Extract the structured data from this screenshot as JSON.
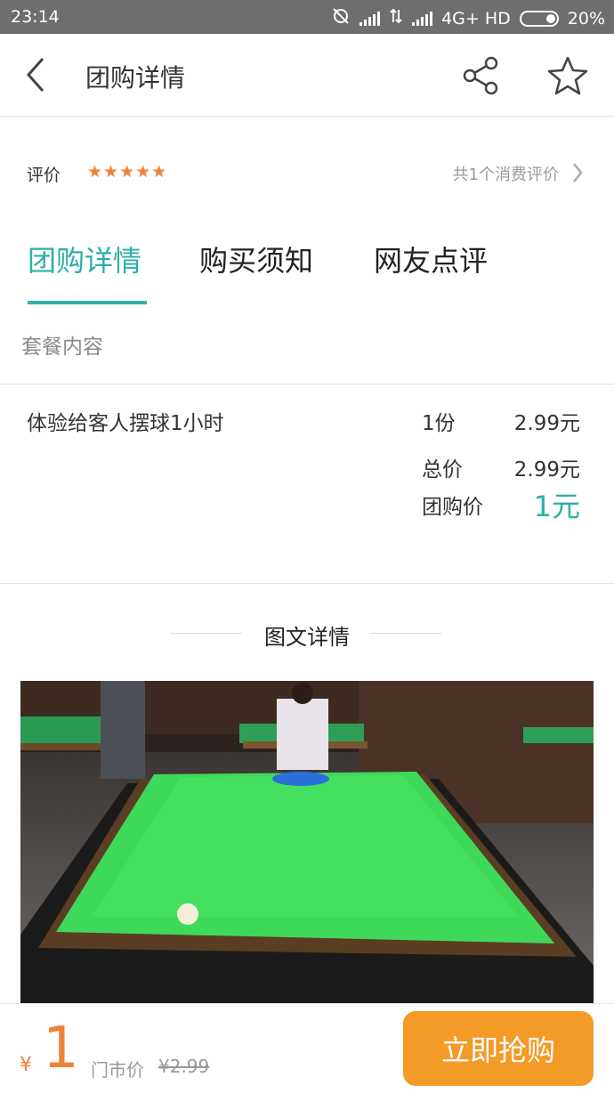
{
  "status_bar": {
    "time": "23:14",
    "network": "4G+ HD",
    "battery": "20%"
  },
  "app_bar": {
    "title": "团购详情",
    "back_icon": "back-arrow-icon",
    "share_icon": "share-icon",
    "favorite_icon": "star-outline-icon"
  },
  "rating": {
    "label": "评价",
    "stars": "★★★★★",
    "count_text": "共1个消费评价"
  },
  "tabs": [
    {
      "label": "团购详情",
      "active": true
    },
    {
      "label": "购买须知",
      "active": false
    },
    {
      "label": "网友点评",
      "active": false
    }
  ],
  "package": {
    "section_label": "套餐内容",
    "item_name": "体验给客人摆球1小时",
    "item_qty": "1份",
    "item_price": "2.99元",
    "total_label": "总价",
    "total_value": "2.99元",
    "group_price_label": "团购价",
    "group_price_value": "1元"
  },
  "details": {
    "heading": "图文详情"
  },
  "bottom_bar": {
    "currency": "¥",
    "price": "1",
    "original_label": "门市价",
    "original_price": "¥2.99",
    "buy_label": "立即抢购"
  },
  "colors": {
    "accent": "#2cb0a7",
    "orange": "#f08236",
    "button": "#f49a26"
  }
}
